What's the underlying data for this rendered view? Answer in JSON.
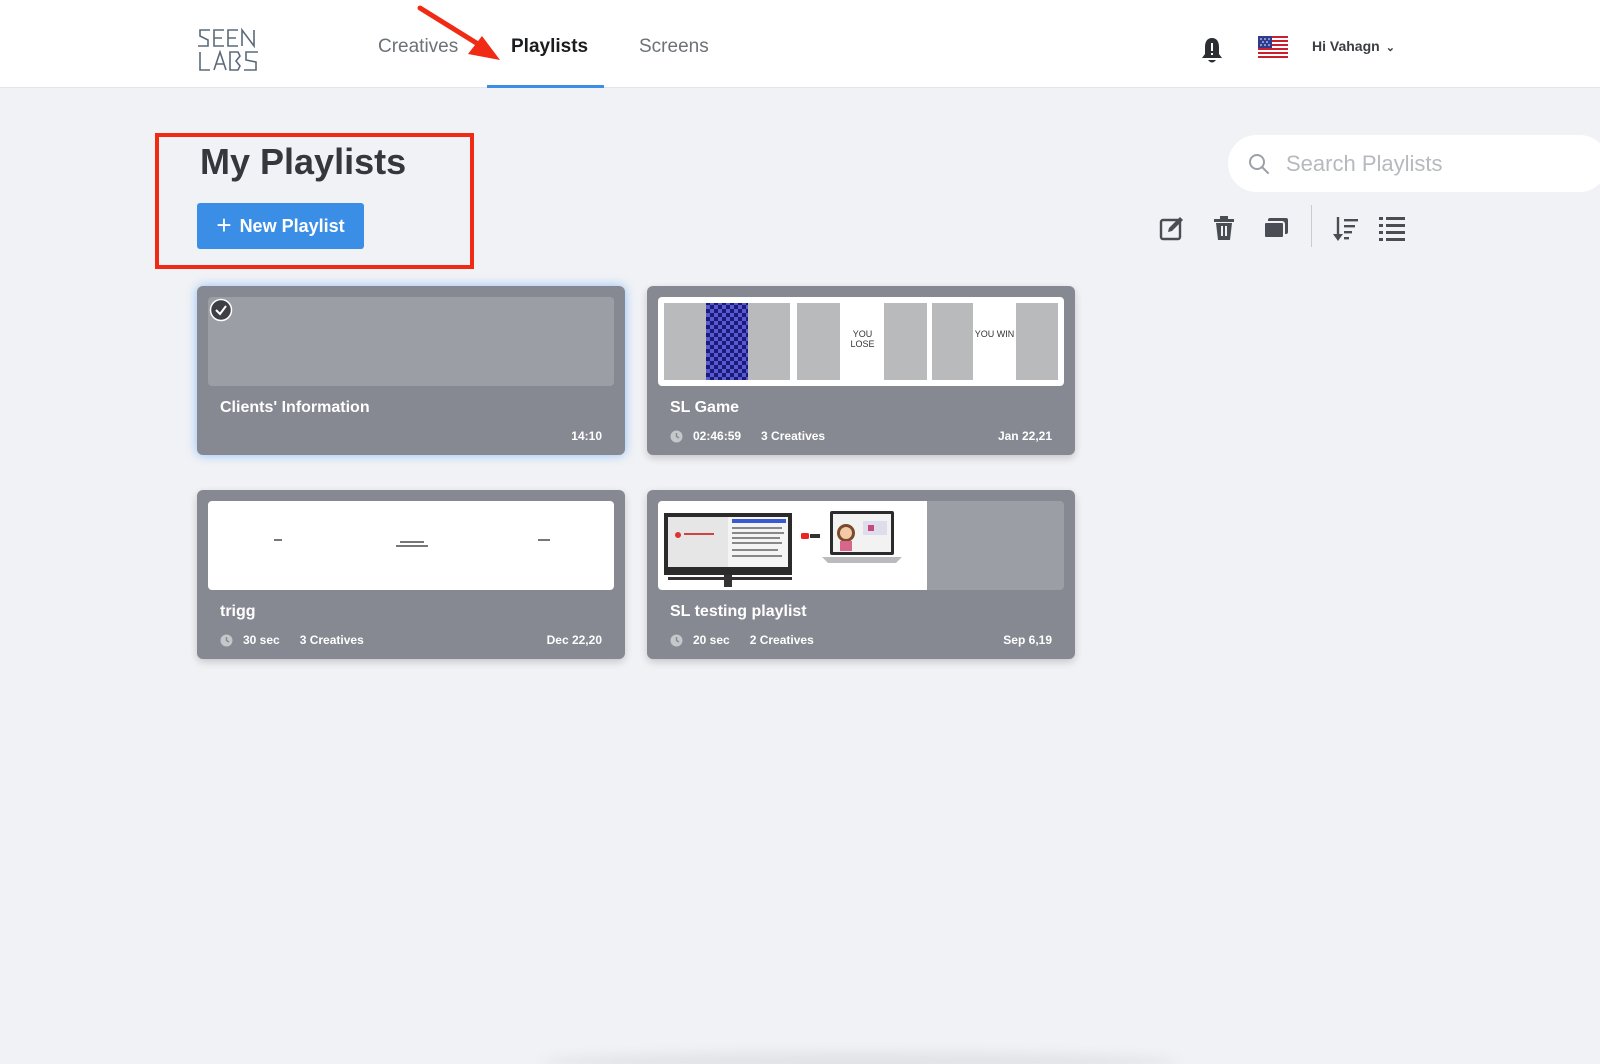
{
  "nav": {
    "tabs": [
      {
        "label": "Creatives"
      },
      {
        "label": "Playlists",
        "active": true
      },
      {
        "label": "Screens"
      }
    ],
    "user_greeting": "Hi Vahagn",
    "logo_text": "SEEN LABS"
  },
  "header": {
    "title": "My Playlists",
    "new_button_label": "New Playlist",
    "search_placeholder": "Search Playlists"
  },
  "toolbar": {
    "icons": [
      "edit-icon",
      "trash-icon",
      "duplicate-icon",
      "sort-icon",
      "list-view-icon"
    ]
  },
  "playlists": [
    {
      "name": "Clients' Information",
      "duration": "",
      "creatives": "",
      "date": "14:10",
      "selected": true
    },
    {
      "name": "SL Game",
      "duration": "02:46:59",
      "creatives": "3 Creatives",
      "date": "Jan 22,21",
      "thumb_labels": [
        "YOU LOSE",
        "YOU WIN"
      ]
    },
    {
      "name": "trigg",
      "duration": "30 sec",
      "creatives": "3 Creatives",
      "date": "Dec 22,20"
    },
    {
      "name": "SL testing playlist",
      "duration": "20 sec",
      "creatives": "2 Creatives",
      "date": "Sep 6,19"
    }
  ],
  "colors": {
    "accent": "#3a8ee6",
    "card_bg": "#868991",
    "annotation_red": "#f02a14"
  }
}
